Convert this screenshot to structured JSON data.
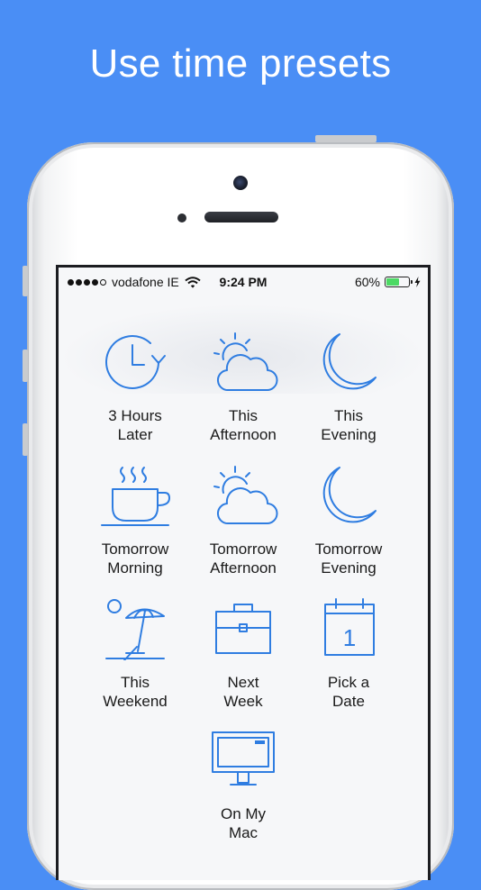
{
  "headline": "Use time presets",
  "accent_color": "#2f7de1",
  "status_bar": {
    "carrier": "vodafone IE",
    "time": "9:24 PM",
    "battery_percent": "60%",
    "battery_level": 0.6,
    "signal_bars": 4,
    "signal_total": 5
  },
  "presets": [
    {
      "label": "3 Hours\nLater",
      "icon": "clock-later-icon"
    },
    {
      "label": "This\nAfternoon",
      "icon": "sun-cloud-icon"
    },
    {
      "label": "This\nEvening",
      "icon": "moon-icon"
    },
    {
      "label": "Tomorrow\nMorning",
      "icon": "coffee-cup-icon"
    },
    {
      "label": "Tomorrow\nAfternoon",
      "icon": "sun-cloud-icon"
    },
    {
      "label": "Tomorrow\nEvening",
      "icon": "moon-icon"
    },
    {
      "label": "This\nWeekend",
      "icon": "beach-umbrella-icon"
    },
    {
      "label": "Next\nWeek",
      "icon": "briefcase-icon"
    },
    {
      "label": "Pick a\nDate",
      "icon": "calendar-icon"
    },
    {
      "label": "On My\nMac",
      "icon": "monitor-icon"
    }
  ],
  "calendar_day": "1"
}
